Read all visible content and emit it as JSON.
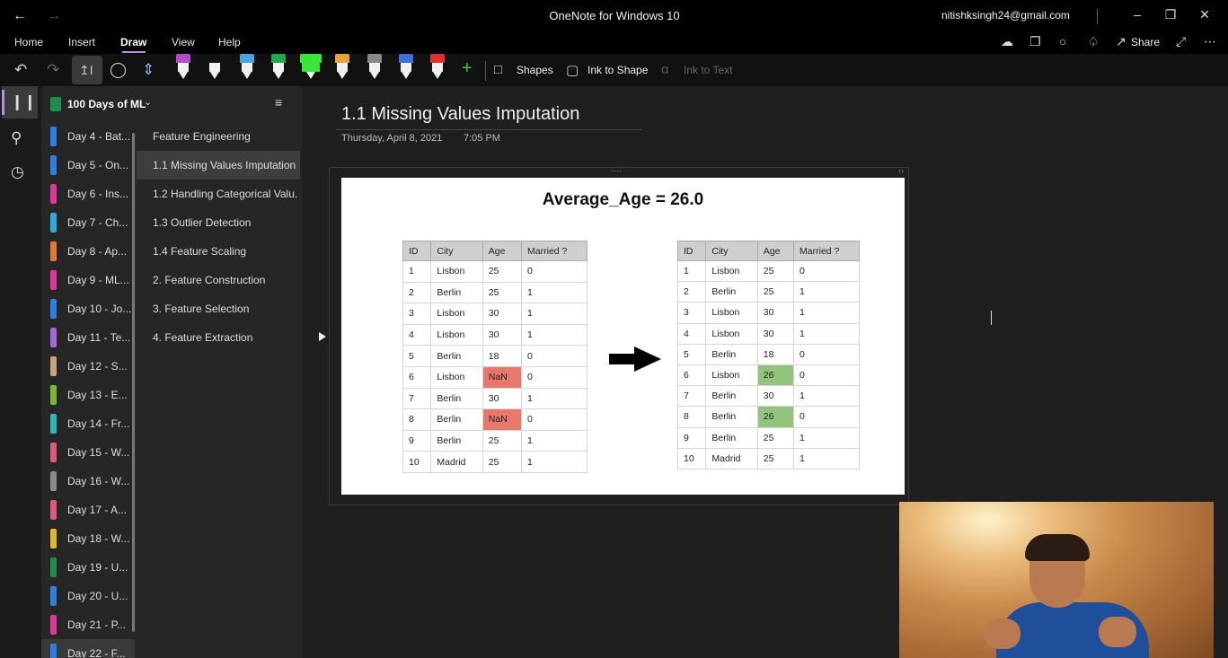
{
  "window": {
    "title": "OneNote for Windows 10",
    "account": "nitishksingh24@gmail.com",
    "controls": [
      "minimize-icon",
      "restore-icon",
      "close-icon"
    ]
  },
  "menu": {
    "items": [
      "Home",
      "Insert",
      "Draw",
      "View",
      "Help"
    ],
    "active": "Draw",
    "share_label": "Share"
  },
  "ribbon": {
    "shapes_label": "Shapes",
    "ink_to_shape_label": "Ink to Shape",
    "ink_to_text_label": "Ink to Text",
    "pen_colors": [
      "#b04ec8",
      "#111111",
      "#4aa3e0",
      "#1ea84a",
      "#39e639",
      "#e8a23a",
      "#888888",
      "#3c6fd8",
      "#e03030"
    ],
    "accent_color": "#b690e0"
  },
  "notebook": {
    "name": "100 Days of ML",
    "sections": [
      {
        "label": "Day 4 - Bat...",
        "color": "#2f7fe0"
      },
      {
        "label": "Day 5 - On...",
        "color": "#2f7fe0"
      },
      {
        "label": "Day 6 - Ins...",
        "color": "#e0359b"
      },
      {
        "label": "Day 7 - Ch...",
        "color": "#2fa8e0"
      },
      {
        "label": "Day 8 - Ap...",
        "color": "#e07a2f"
      },
      {
        "label": "Day 9 - ML...",
        "color": "#e0359b"
      },
      {
        "label": "Day 10 - Jo...",
        "color": "#2f7fe0"
      },
      {
        "label": "Day 11 - Te...",
        "color": "#a66ad8"
      },
      {
        "label": "Day 12 - S...",
        "color": "#c8a27a"
      },
      {
        "label": "Day 13 - E...",
        "color": "#7ab82f"
      },
      {
        "label": "Day 14 - Fr...",
        "color": "#2fb8b8"
      },
      {
        "label": "Day 15 - W...",
        "color": "#e05a7a"
      },
      {
        "label": "Day 16 - W...",
        "color": "#8a8a8a"
      },
      {
        "label": "Day 17 - A...",
        "color": "#e05a7a"
      },
      {
        "label": "Day 18 - W...",
        "color": "#e0b82f"
      },
      {
        "label": "Day 19 - U...",
        "color": "#1e8e4e"
      },
      {
        "label": "Day 20 - U...",
        "color": "#2f7fe0"
      },
      {
        "label": "Day 21 - P...",
        "color": "#e0359b"
      },
      {
        "label": "Day 22 - F...",
        "color": "#2f7fe0"
      }
    ],
    "active_section": "Day 22 - F..."
  },
  "pages": [
    {
      "label": "Feature Engineering",
      "selected": false
    },
    {
      "label": "1.1 Missing Values Imputation",
      "selected": true
    },
    {
      "label": "1.2 Handling Categorical Valu...",
      "selected": false
    },
    {
      "label": "1.3 Outlier Detection",
      "selected": false
    },
    {
      "label": "1.4 Feature Scaling",
      "selected": false
    },
    {
      "label": "2. Feature Construction",
      "selected": false
    },
    {
      "label": "3. Feature Selection",
      "selected": false
    },
    {
      "label": "4. Feature Extraction",
      "selected": false
    }
  ],
  "page": {
    "title": "1.1 Missing Values Imputation",
    "date": "Thursday, April 8, 2021",
    "time": "7:05 PM"
  },
  "slide": {
    "title": "Average_Age  = 26.0",
    "headers_left": [
      "ID",
      "City",
      "Age",
      "Married ?"
    ],
    "headers_right": [
      "ID",
      "City",
      "Age",
      "Married ?"
    ],
    "rows_before": [
      [
        "1",
        "Lisbon",
        "25",
        "0"
      ],
      [
        "2",
        "Berlin",
        "25",
        "1"
      ],
      [
        "3",
        "Lisbon",
        "30",
        "1"
      ],
      [
        "4",
        "Lisbon",
        "30",
        "1"
      ],
      [
        "5",
        "Berlin",
        "18",
        "0"
      ],
      [
        "6",
        "Lisbon",
        "NaN",
        "0"
      ],
      [
        "7",
        "Berlin",
        "30",
        "1"
      ],
      [
        "8",
        "Berlin",
        "NaN",
        "0"
      ],
      [
        "9",
        "Berlin",
        "25",
        "1"
      ],
      [
        "10",
        "Madrid",
        "25",
        "1"
      ]
    ],
    "rows_after": [
      [
        "1",
        "Lisbon",
        "25",
        "0"
      ],
      [
        "2",
        "Berlin",
        "25",
        "1"
      ],
      [
        "3",
        "Lisbon",
        "30",
        "1"
      ],
      [
        "4",
        "Lisbon",
        "30",
        "1"
      ],
      [
        "5",
        "Berlin",
        "18",
        "0"
      ],
      [
        "6",
        "Lisbon",
        "26",
        "0"
      ],
      [
        "7",
        "Berlin",
        "30",
        "1"
      ],
      [
        "8",
        "Berlin",
        "26",
        "0"
      ],
      [
        "9",
        "Berlin",
        "25",
        "1"
      ],
      [
        "10",
        "Madrid",
        "25",
        "1"
      ]
    ],
    "missing_color": "#e8786c",
    "imputed_color": "#93c47d"
  }
}
